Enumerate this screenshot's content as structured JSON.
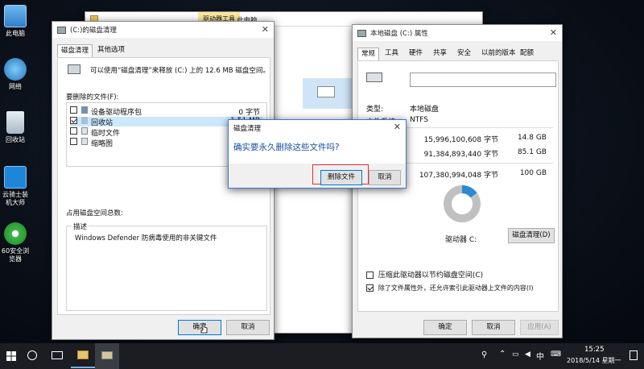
{
  "desktop": {
    "icons": [
      {
        "label": "此电脑"
      },
      {
        "label": "网络"
      },
      {
        "label": "回收站"
      },
      {
        "label": "云骑士装机大师"
      },
      {
        "label": "60安全浏览器"
      }
    ]
  },
  "explorer_bg": {
    "tab_label": "驱动器工具",
    "title": "此电脑"
  },
  "cleanup": {
    "title": "(C:)的磁盘清理",
    "tabs": [
      "磁盘清理",
      "其他选项"
    ],
    "summary": "可以使用“磁盘清理”来释放 (C:) 上的 12.6 MB 磁盘空间。",
    "files_label": "要删除的文件(F):",
    "files": [
      {
        "name": "设备驱动程序包",
        "size": "0 字节",
        "checked": false
      },
      {
        "name": "回收站",
        "size": "1.51 MB",
        "checked": true
      },
      {
        "name": "临时文件",
        "size": "",
        "checked": false
      },
      {
        "name": "缩略图",
        "size": "6",
        "checked": false
      }
    ],
    "total_label": "占用磁盘空间总数:",
    "desc_label": "描述",
    "desc_text": "Windows Defender 防病毒使用的非关键文件",
    "ok": "确定",
    "cancel": "取消"
  },
  "properties": {
    "title": "本地磁盘 (C:) 属性",
    "tabs": [
      "常规",
      "工具",
      "硬件",
      "共享",
      "安全",
      "以前的版本",
      "配额"
    ],
    "type_label": "类型:",
    "type_value": "本地磁盘",
    "fs_label": "文件系统:",
    "fs_value": "NTFS",
    "used_bytes": "15,996,100,608 字节",
    "used_gb": "14.8 GB",
    "free_bytes": "91,384,893,440 字节",
    "free_gb": "85.1 GB",
    "cap_bytes": "107,380,994,048 字节",
    "cap_gb": "100 GB",
    "drive_label": "驱动器 C:",
    "cleanup_btn": "磁盘清理(D)",
    "compress_label": "压缩此驱动器以节约磁盘空间(C)",
    "index_label": "除了文件属性外，还允许索引此驱动器上文件的内容(I)",
    "compress_checked": false,
    "index_checked": true,
    "ok": "确定",
    "cancel": "取消",
    "apply": "应用(A)",
    "used_fraction": 0.149,
    "colors": {
      "used": "#2a8ad4",
      "free": "#c0c0c0"
    }
  },
  "confirm": {
    "title": "磁盘清理",
    "message": "确实要永久删除这些文件吗?",
    "delete": "删除文件",
    "cancel": "取消"
  },
  "taskbar": {
    "time": "15:25",
    "date": "2018/5/14 星期一",
    "ime": "中"
  }
}
